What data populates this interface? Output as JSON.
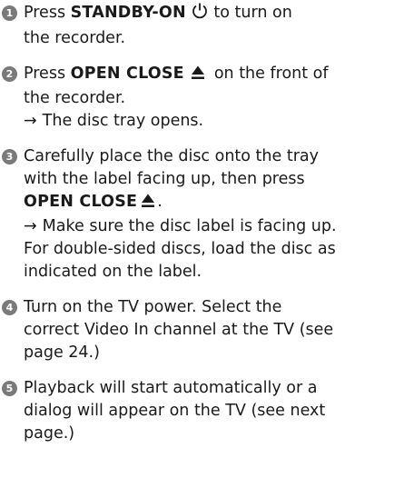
{
  "steps": [
    {
      "num": "1",
      "prefix": "Press ",
      "button": "STANDBY-ON",
      "icon": "power-icon",
      "suffix": " to turn on",
      "line2": "the recorder."
    },
    {
      "num": "2",
      "prefix": "Press ",
      "button": "OPEN CLOSE",
      "icon": "eject-icon",
      "suffix": "on the front of",
      "line2": "the recorder.",
      "note_arrow": "→",
      "note": "The disc tray opens."
    },
    {
      "num": "3",
      "line1": "Carefully place the disc onto the tray",
      "line2": "with the label facing up, then press",
      "button": "OPEN CLOSE",
      "icon": "eject-icon",
      "button_suffix": ".",
      "note_arrow": "→",
      "note": "Make sure the disc label is facing up.",
      "extra1": "For double-sided discs, load the disc as",
      "extra2": "indicated on the label."
    },
    {
      "num": "4",
      "line1": "Turn on the TV power. Select the",
      "line2": "correct Video In channel at the TV (see",
      "line3": "page 24.)"
    },
    {
      "num": "5",
      "line1": "Playback will start automatically or a",
      "line2": "dialog will appear on the TV (see next",
      "line3": "page.)"
    }
  ]
}
